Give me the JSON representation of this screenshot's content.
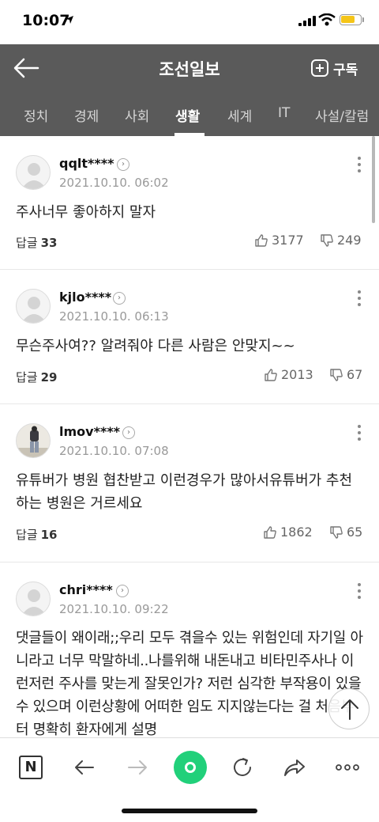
{
  "status_bar": {
    "time": "10:07"
  },
  "header": {
    "title": "조선일보",
    "subscribe_label": "구독"
  },
  "tabs": [
    {
      "label": "정치"
    },
    {
      "label": "경제"
    },
    {
      "label": "사회"
    },
    {
      "label": "생활",
      "active": true
    },
    {
      "label": "세계"
    },
    {
      "label": "IT"
    },
    {
      "label": "사설/칼럼"
    }
  ],
  "reply_label": "답글",
  "comments": [
    {
      "username": "qqlt****",
      "timestamp": "2021.10.10. 06:02",
      "text": "주사너무 좋아하지 말자",
      "replies": "33",
      "likes": "3177",
      "dislikes": "249"
    },
    {
      "username": "kjlo****",
      "timestamp": "2021.10.10. 06:13",
      "text": "무슨주사여?? 알려줘야 다른 사람은 안맞지~~",
      "replies": "29",
      "likes": "2013",
      "dislikes": "67"
    },
    {
      "username": "lmov****",
      "timestamp": "2021.10.10. 07:08",
      "text": "유튜버가 병원 협찬받고 이런경우가 많아서유튜버가 추천하는 병원은 거르세요",
      "replies": "16",
      "likes": "1862",
      "dislikes": "65"
    },
    {
      "username": "chri****",
      "timestamp": "2021.10.10. 09:22",
      "text": "댓글들이 왜이래;;우리 모두 겪을수 있는 위험인데 자기일 아니라고 너무 막말하네..나를위해 내돈내고 비타민주사나 이런저런 주사를 맞는게 잘못인가? 저런 심각한 부작용이 있을수 있으며 이런상황에 어떠한 임도 지지않는다는 걸 처음부터 명확히 환자에게 설명"
    }
  ],
  "bottom_nav": {
    "logo_letter": "N",
    "icons": [
      "naver-logo-icon",
      "back-arrow-icon",
      "forward-arrow-icon",
      "green-home-icon",
      "refresh-icon",
      "share-icon",
      "more-dots-icon"
    ]
  },
  "colors": {
    "header_bg": "#5a5a5a",
    "accent_green": "#21d07a",
    "battery": "#f5c518"
  }
}
